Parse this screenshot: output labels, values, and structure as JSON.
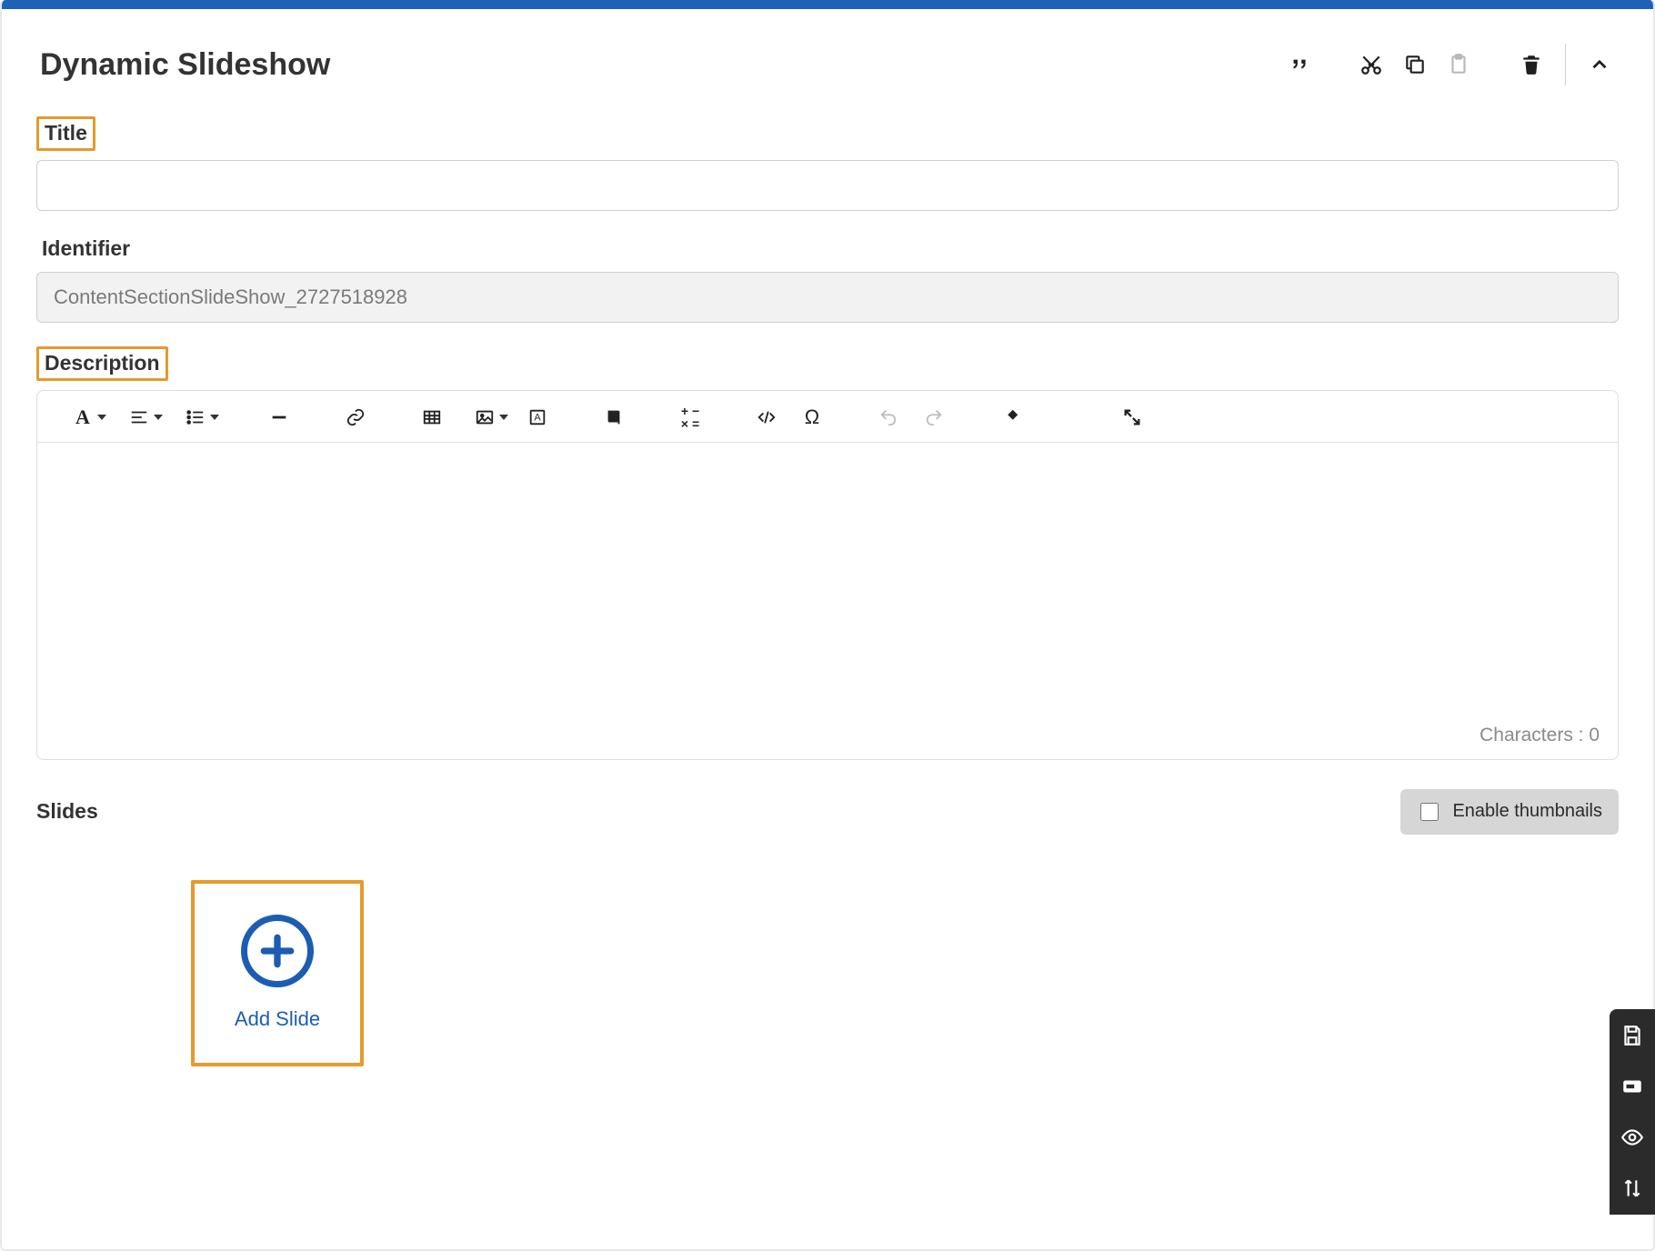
{
  "header": {
    "title": "Dynamic Slideshow"
  },
  "fields": {
    "title": {
      "label": "Title",
      "value": ""
    },
    "identifier": {
      "label": "Identifier",
      "value": "ContentSectionSlideShow_2727518928"
    },
    "description": {
      "label": "Description"
    }
  },
  "editor": {
    "char_label": "Characters : 0"
  },
  "slides": {
    "label": "Slides",
    "thumb_toggle": "Enable thumbnails",
    "add_label": "Add Slide"
  }
}
